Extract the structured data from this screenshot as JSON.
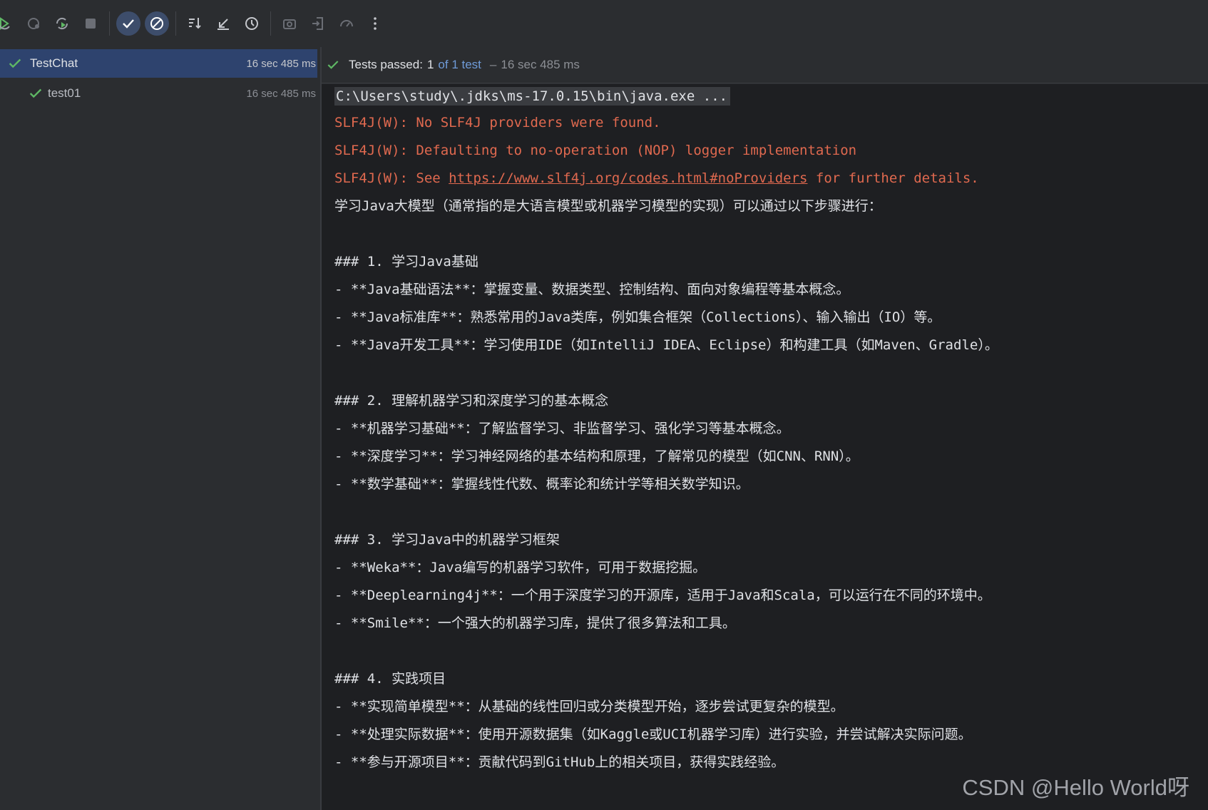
{
  "toolbar": {
    "icons": [
      "rerun-icon",
      "rerun-failed-icon",
      "toggle-auto-test-icon",
      "stop-icon",
      "show-passed-icon",
      "show-ignored-icon",
      "sort-icon",
      "collapse-icon",
      "history-icon",
      "screenshot-icon",
      "import-icon",
      "export-icon",
      "more-icon"
    ]
  },
  "tree": {
    "root": {
      "name": "TestChat",
      "duration": "16 sec 485 ms"
    },
    "child": {
      "name": "test01",
      "duration": "16 sec 485 ms"
    }
  },
  "status": {
    "passed_label": "Tests passed:",
    "count": "1",
    "of_label": "of 1 test",
    "dash": "–",
    "time": "16 sec 485 ms"
  },
  "console": {
    "cmd": "C:\\Users\\study\\.jdks\\ms-17.0.15\\bin\\java.exe ...",
    "warn1": "SLF4J(W): No SLF4J providers were found.",
    "warn2": "SLF4J(W): Defaulting to no-operation (NOP) logger implementation",
    "warn3_prefix": "SLF4J(W): See ",
    "warn3_link": "https://www.slf4j.org/codes.html#noProviders",
    "warn3_suffix": " for further details.",
    "lines": [
      "学习Java大模型（通常指的是大语言模型或机器学习模型的实现）可以通过以下步骤进行：",
      "",
      "### 1. 学习Java基础",
      "- **Java基础语法**：掌握变量、数据类型、控制结构、面向对象编程等基本概念。",
      "- **Java标准库**：熟悉常用的Java类库，例如集合框架（Collections）、输入输出（IO）等。",
      "- **Java开发工具**：学习使用IDE（如IntelliJ IDEA、Eclipse）和构建工具（如Maven、Gradle）。",
      "",
      "### 2. 理解机器学习和深度学习的基本概念",
      "- **机器学习基础**：了解监督学习、非监督学习、强化学习等基本概念。",
      "- **深度学习**：学习神经网络的基本结构和原理，了解常见的模型（如CNN、RNN）。",
      "- **数学基础**：掌握线性代数、概率论和统计学等相关数学知识。",
      "",
      "### 3. 学习Java中的机器学习框架",
      "- **Weka**：Java编写的机器学习软件，可用于数据挖掘。",
      "- **Deeplearning4j**：一个用于深度学习的开源库，适用于Java和Scala，可以运行在不同的环境中。",
      "- **Smile**：一个强大的机器学习库，提供了很多算法和工具。",
      "",
      "### 4. 实践项目",
      "- **实现简单模型**：从基础的线性回归或分类模型开始，逐步尝试更复杂的模型。",
      "- **处理实际数据**：使用开源数据集（如Kaggle或UCI机器学习库）进行实验，并尝试解决实际问题。",
      "- **参与开源项目**：贡献代码到GitHub上的相关项目，获得实践经验。"
    ]
  },
  "watermark": "CSDN @Hello World呀",
  "colors": {
    "accent": "#4b9c52",
    "warn": "#e0694f",
    "selection": "#2e436e",
    "link_blue": "#6f9bd8"
  }
}
